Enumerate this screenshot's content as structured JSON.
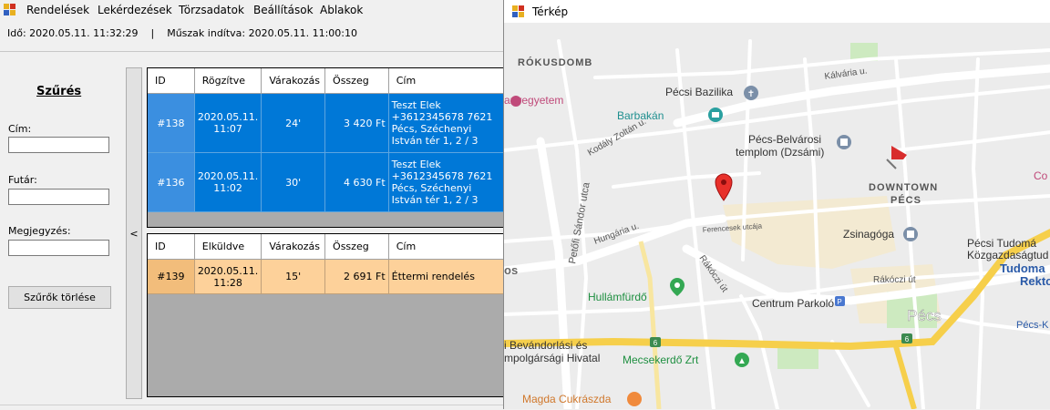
{
  "menu": {
    "items": [
      "Rendelések",
      "Lekérdezések",
      "Törzsadatok",
      "Beállítások",
      "Ablakok"
    ]
  },
  "status": {
    "text": "Idő: 2020.05.11. 11:32:29    |    Műszak indítva: 2020.05.11. 11:00:10"
  },
  "filter": {
    "title": "Szűrés",
    "address_label": "Cím:",
    "courier_label": "Futár:",
    "note_label": "Megjegyzés:",
    "clear_button": "Szűrők törlése",
    "collapse_glyph": "<"
  },
  "grid_top": {
    "headers": [
      "ID",
      "Rögzítve",
      "Várakozás",
      "Összeg",
      "Cím"
    ],
    "rows": [
      {
        "id": "#138",
        "time": "2020.05.11. 11:07",
        "wait": "24'",
        "amount": "3 420 Ft",
        "address": "Teszt Elek +3612345678 7621 Pécs, Széchenyi István tér 1, 2 / 3"
      },
      {
        "id": "#136",
        "time": "2020.05.11. 11:02",
        "wait": "30'",
        "amount": "4 630 Ft",
        "address": "Teszt Elek +3612345678 7621 Pécs, Széchenyi István tér 1, 2 / 3"
      }
    ]
  },
  "grid_bottom": {
    "headers": [
      "ID",
      "Elküldve",
      "Várakozás",
      "Összeg",
      "Cím"
    ],
    "rows": [
      {
        "id": "#139",
        "time": "2020.05.11. 11:28",
        "wait": "15'",
        "amount": "2 691 Ft",
        "address": "Éttermi rendelés"
      }
    ]
  },
  "map": {
    "title": "Térkép",
    "labels": {
      "rokusdomb": "RÓKUSDOMB",
      "downtown1": "DOWNTOWN",
      "downtown2": "PÉCS",
      "bazilika": "Pécsi Bazilika",
      "barbakan": "Barbakán",
      "templom1": "Pécs-Belvárosi",
      "templom2": "templom (Dzsámi)",
      "zsinagoga": "Zsinagóga",
      "hullamfurdo": "Hullámfürdő",
      "centrum": "Centrum Parkoló",
      "pecs": "Pécs",
      "mecsekerdo": "Mecsekerdő Zrt",
      "magda": "Magda Cukrászda",
      "bevandorlasi1": "i Bevándorlási és",
      "bevandorlasi2": "mpolgársági Hivatal",
      "egyetem": "anyegyetem",
      "tudomany1": "Pécsi Tudomá",
      "tudomany2": "Közgazdaságtud",
      "tudomany3": "Tudoma",
      "tudomany4": "Rekto",
      "pecsk": "Pécs-K",
      "petofi": "Petőfi Sándor utca",
      "hungaria": "Hungária u.",
      "rakoczi1": "Rákóczi út",
      "rakoczi2": "Rákóczi út",
      "kalvaria": "Kálvária u.",
      "kodaly": "Kodály Zoltán u.",
      "ferencesek": "Ferencesek utcája",
      "road6a": "6",
      "road6b": "6",
      "os": "os",
      "co": "Co"
    }
  }
}
